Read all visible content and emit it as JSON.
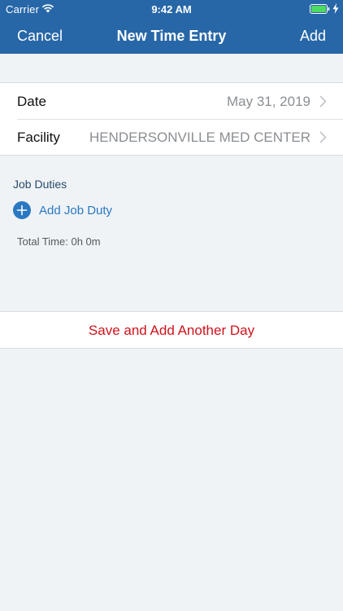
{
  "status_bar": {
    "carrier": "Carrier",
    "time": "9:42 AM",
    "icons": [
      "wifi-icon",
      "battery-icon",
      "charging-bolt-icon"
    ]
  },
  "nav": {
    "cancel_label": "Cancel",
    "title": "New Time Entry",
    "add_label": "Add"
  },
  "form": {
    "rows": [
      {
        "label": "Date",
        "value": "May 31, 2019"
      },
      {
        "label": "Facility",
        "value": "HENDERSONVILLE MED CENTER"
      }
    ]
  },
  "job_duties": {
    "section_title": "Job Duties",
    "add_label": "Add Job Duty",
    "total_time": "Total Time: 0h 0m"
  },
  "actions": {
    "save_another_label": "Save and Add Another Day"
  },
  "colors": {
    "header_blue": "#2767a8",
    "background": "#eff3f6",
    "link_blue": "#2b78c2",
    "destructive_red": "#d0121b"
  }
}
